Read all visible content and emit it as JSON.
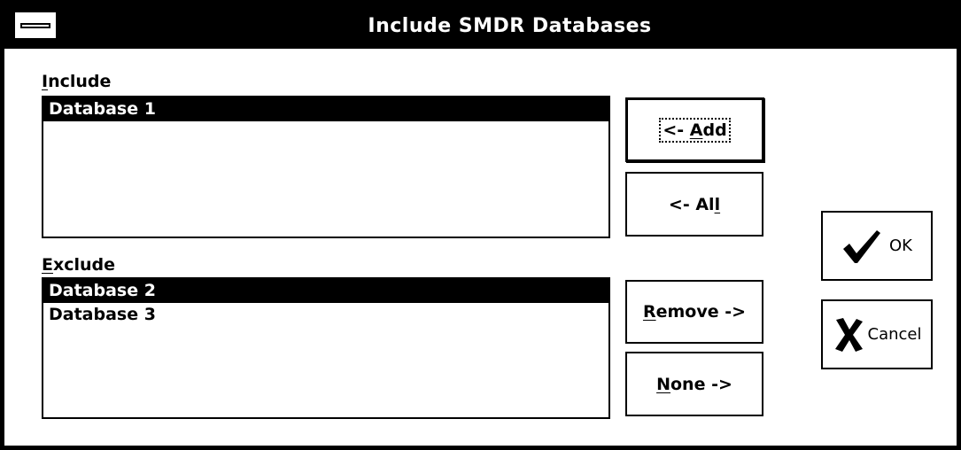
{
  "window": {
    "title": "Include SMDR Databases"
  },
  "include": {
    "label_mnemonic": "I",
    "label_rest": "nclude",
    "items": [
      {
        "label": "Database 1",
        "selected": true
      }
    ]
  },
  "exclude": {
    "label_mnemonic": "E",
    "label_rest": "xclude",
    "items": [
      {
        "label": "Database 2",
        "selected": true
      },
      {
        "label": "Database 3",
        "selected": false
      }
    ]
  },
  "buttons": {
    "add": {
      "prefix": "<- ",
      "mnemonic": "A",
      "rest": "dd"
    },
    "all": {
      "prefix": "<- Al",
      "mnemonic": "l",
      "rest": ""
    },
    "remove": {
      "prefix": "",
      "mnemonic": "R",
      "rest": "emove ->"
    },
    "none": {
      "prefix": "",
      "mnemonic": "N",
      "rest": "one ->"
    },
    "ok": {
      "label": "OK",
      "icon": "checkmark-icon"
    },
    "cancel": {
      "label": "Cancel",
      "icon": "x-mark-icon"
    }
  }
}
